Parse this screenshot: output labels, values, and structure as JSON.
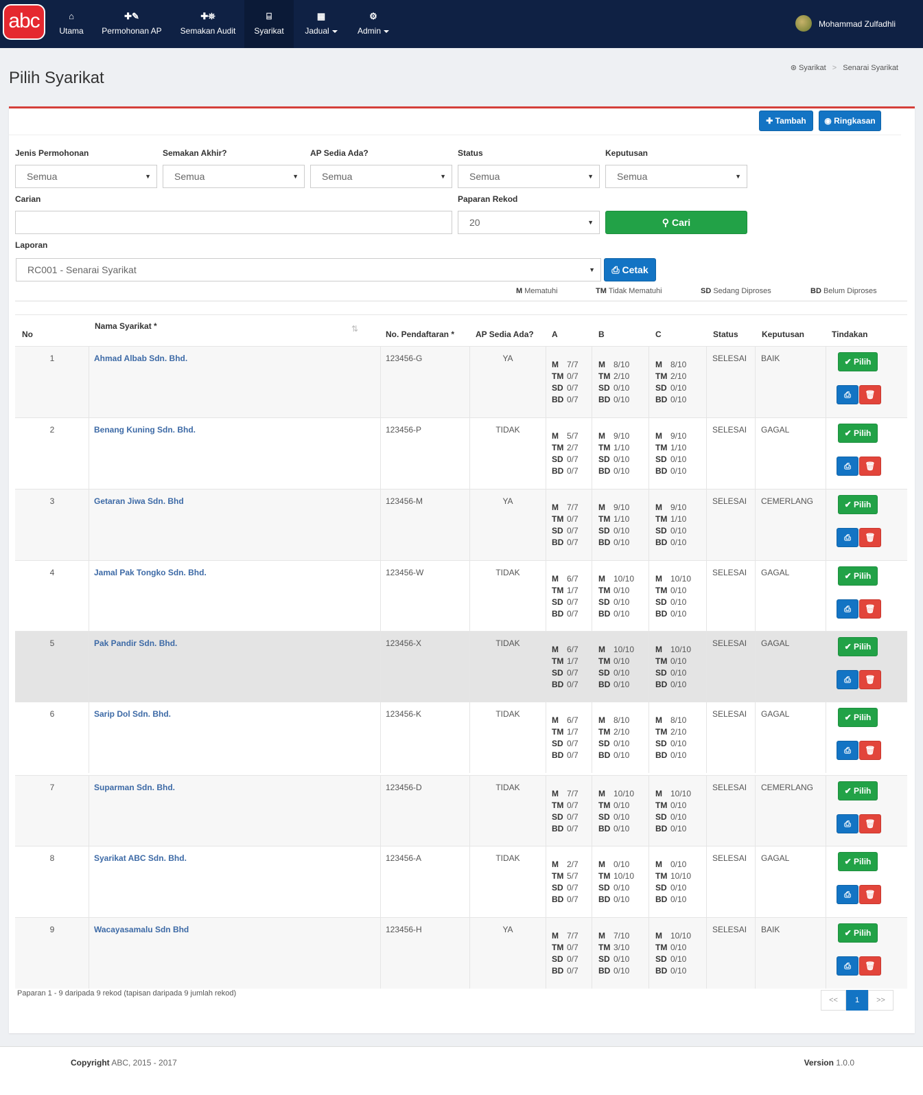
{
  "nav": {
    "logo": "abc",
    "items": [
      {
        "icon": "⌂",
        "label": "Utama"
      },
      {
        "icon": "✚✎",
        "label": "Permohonan AP"
      },
      {
        "icon": "✚⛯",
        "label": "Semakan Audit"
      },
      {
        "icon": "⌸",
        "label": "Syarikat"
      },
      {
        "icon": "▦",
        "label": "Jadual"
      },
      {
        "icon": "⚙",
        "label": "Admin"
      }
    ],
    "user": "Mohammad Zulfadhli"
  },
  "page": {
    "title": "Pilih Syarikat",
    "breadcrumb": [
      "Syarikat",
      "Senarai Syarikat"
    ]
  },
  "actions": {
    "tambah": "Tambah",
    "ringkasan": "Ringkasan"
  },
  "filters": {
    "jenis_label": "Jenis Permohonan",
    "jenis_value": "Semua",
    "semakan_label": "Semakan Akhir?",
    "semakan_value": "Semua",
    "ap_label": "AP Sedia Ada?",
    "ap_value": "Semua",
    "status_label": "Status",
    "status_value": "Semua",
    "keputusan_label": "Keputusan",
    "keputusan_value": "Semua",
    "carian_label": "Carian",
    "carian_value": "",
    "paparan_label": "Paparan Rekod",
    "paparan_value": "20",
    "cari": "Cari",
    "laporan_label": "Laporan",
    "laporan_value": "RC001 - Senarai Syarikat",
    "cetak": "Cetak"
  },
  "legend": [
    {
      "code": "M",
      "text": "Mematuhi"
    },
    {
      "code": "TM",
      "text": "Tidak Mematuhi"
    },
    {
      "code": "SD",
      "text": "Sedang Diproses"
    },
    {
      "code": "BD",
      "text": "Belum Diproses"
    }
  ],
  "table": {
    "headers": [
      "No",
      "Nama Syarikat *",
      "No. Pendaftaran *",
      "AP Sedia Ada?",
      "A",
      "B",
      "C",
      "Status",
      "Keputusan",
      "Tindakan"
    ],
    "pilih_label": "Pilih",
    "rows": [
      {
        "no": "1",
        "name": "Ahmad Albab Sdn. Bhd.",
        "reg": "123456-G",
        "ap": "YA",
        "A": [
          "7/7",
          "0/7",
          "0/7",
          "0/7"
        ],
        "B": [
          "8/10",
          "2/10",
          "0/10",
          "0/10"
        ],
        "C": [
          "8/10",
          "2/10",
          "0/10",
          "0/10"
        ],
        "status": "SELESAI",
        "keputusan": "BAIK"
      },
      {
        "no": "2",
        "name": "Benang Kuning Sdn. Bhd.",
        "reg": "123456-P",
        "ap": "TIDAK",
        "A": [
          "5/7",
          "2/7",
          "0/7",
          "0/7"
        ],
        "B": [
          "9/10",
          "1/10",
          "0/10",
          "0/10"
        ],
        "C": [
          "9/10",
          "1/10",
          "0/10",
          "0/10"
        ],
        "status": "SELESAI",
        "keputusan": "GAGAL"
      },
      {
        "no": "3",
        "name": "Getaran Jiwa Sdn. Bhd",
        "reg": "123456-M",
        "ap": "YA",
        "A": [
          "7/7",
          "0/7",
          "0/7",
          "0/7"
        ],
        "B": [
          "9/10",
          "1/10",
          "0/10",
          "0/10"
        ],
        "C": [
          "9/10",
          "1/10",
          "0/10",
          "0/10"
        ],
        "status": "SELESAI",
        "keputusan": "CEMERLANG"
      },
      {
        "no": "4",
        "name": "Jamal Pak Tongko Sdn. Bhd.",
        "reg": "123456-W",
        "ap": "TIDAK",
        "A": [
          "6/7",
          "1/7",
          "0/7",
          "0/7"
        ],
        "B": [
          "10/10",
          "0/10",
          "0/10",
          "0/10"
        ],
        "C": [
          "10/10",
          "0/10",
          "0/10",
          "0/10"
        ],
        "status": "SELESAI",
        "keputusan": "GAGAL"
      },
      {
        "no": "5",
        "name": "Pak Pandir Sdn.  Bhd.",
        "reg": "123456-X",
        "ap": "TIDAK",
        "A": [
          "6/7",
          "1/7",
          "0/7",
          "0/7"
        ],
        "B": [
          "10/10",
          "0/10",
          "0/10",
          "0/10"
        ],
        "C": [
          "10/10",
          "0/10",
          "0/10",
          "0/10"
        ],
        "status": "SELESAI",
        "keputusan": "GAGAL"
      },
      {
        "no": "6",
        "name": "Sarip Dol Sdn. Bhd.",
        "reg": "123456-K",
        "ap": "TIDAK",
        "A": [
          "6/7",
          "1/7",
          "0/7",
          "0/7"
        ],
        "B": [
          "8/10",
          "2/10",
          "0/10",
          "0/10"
        ],
        "C": [
          "8/10",
          "2/10",
          "0/10",
          "0/10"
        ],
        "status": "SELESAI",
        "keputusan": "GAGAL"
      },
      {
        "no": "7",
        "name": "Suparman Sdn. Bhd.",
        "reg": "123456-D",
        "ap": "TIDAK",
        "A": [
          "7/7",
          "0/7",
          "0/7",
          "0/7"
        ],
        "B": [
          "10/10",
          "0/10",
          "0/10",
          "0/10"
        ],
        "C": [
          "10/10",
          "0/10",
          "0/10",
          "0/10"
        ],
        "status": "SELESAI",
        "keputusan": "CEMERLANG"
      },
      {
        "no": "8",
        "name": "Syarikat ABC Sdn. Bhd.",
        "reg": "123456-A",
        "ap": "TIDAK",
        "A": [
          "2/7",
          "5/7",
          "0/7",
          "0/7"
        ],
        "B": [
          "0/10",
          "10/10",
          "0/10",
          "0/10"
        ],
        "C": [
          "0/10",
          "10/10",
          "0/10",
          "0/10"
        ],
        "status": "SELESAI",
        "keputusan": "GAGAL"
      },
      {
        "no": "9",
        "name": "Wacayasamalu Sdn Bhd",
        "reg": "123456-H",
        "ap": "YA",
        "A": [
          "7/7",
          "0/7",
          "0/7",
          "0/7"
        ],
        "B": [
          "7/10",
          "3/10",
          "0/10",
          "0/10"
        ],
        "C": [
          "10/10",
          "0/10",
          "0/10",
          "0/10"
        ],
        "status": "SELESAI",
        "keputusan": "BAIK"
      }
    ]
  },
  "pagination": {
    "summary": "Paparan 1 - 9 daripada 9 rekod (tapisan daripada 9 jumlah rekod)",
    "prev": "<<",
    "current": "1",
    "next": ">>"
  },
  "footer": {
    "copyright_label": "Copyright",
    "copyright_text": "ABC, 2015 - 2017",
    "version_label": "Version",
    "version": "1.0.0"
  },
  "colors": {
    "navbar": "#0f2144",
    "accent_red": "#d43f3a",
    "primary": "#1374c4",
    "success": "#22a247",
    "danger": "#e2453b"
  }
}
